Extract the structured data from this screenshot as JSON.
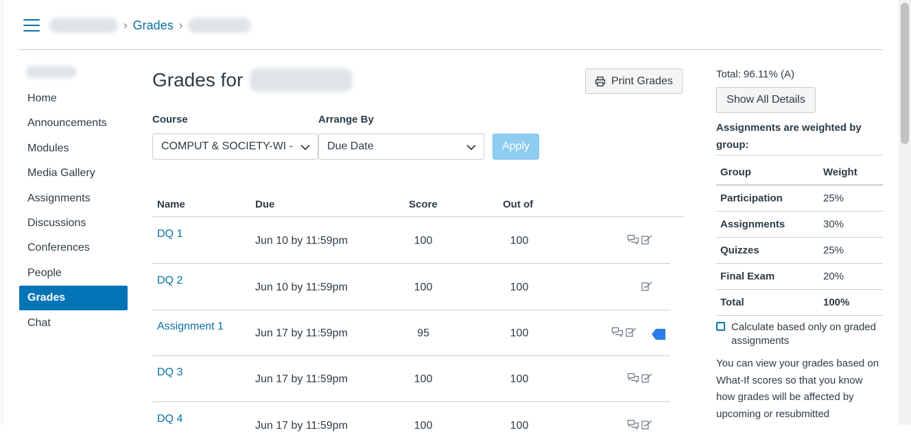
{
  "breadcrumb": {
    "current": "Grades"
  },
  "sidebar": {
    "items": [
      {
        "label": "Home"
      },
      {
        "label": "Announcements"
      },
      {
        "label": "Modules"
      },
      {
        "label": "Media Gallery"
      },
      {
        "label": "Assignments"
      },
      {
        "label": "Discussions"
      },
      {
        "label": "Conferences"
      },
      {
        "label": "People"
      },
      {
        "label": "Grades",
        "active": true
      },
      {
        "label": "Chat"
      }
    ]
  },
  "main": {
    "title": "Grades for",
    "print_label": "Print Grades",
    "course_label": "Course",
    "course_value": "COMPUT & SOCIETY-WI -",
    "arrange_label": "Arrange By",
    "arrange_value": "Due Date",
    "apply_label": "Apply",
    "columns": {
      "name": "Name",
      "due": "Due",
      "score": "Score",
      "out_of": "Out of"
    },
    "rows": [
      {
        "name": "DQ 1",
        "due": "Jun 10 by 11:59pm",
        "score": "100",
        "out_of": "100",
        "icons": [
          "comments-icon",
          "rubric-icon"
        ]
      },
      {
        "name": "DQ 2",
        "due": "Jun 10 by 11:59pm",
        "score": "100",
        "out_of": "100",
        "icons": [
          "rubric-icon"
        ]
      },
      {
        "name": "Assignment 1",
        "due": "Jun 17 by 11:59pm",
        "score": "95",
        "out_of": "100",
        "icons": [
          "comments-icon",
          "rubric-icon"
        ],
        "flag": true
      },
      {
        "name": "DQ 3",
        "due": "Jun 17 by 11:59pm",
        "score": "100",
        "out_of": "100",
        "icons": [
          "comments-icon",
          "rubric-icon"
        ]
      },
      {
        "name": "DQ 4",
        "due": "Jun 17 by 11:59pm",
        "score": "100",
        "out_of": "100",
        "icons": [
          "comments-icon",
          "rubric-icon"
        ]
      }
    ]
  },
  "sidebar_right": {
    "total": "Total: 96.11% (A)",
    "show_details_label": "Show All Details",
    "weighted_text": "Assignments are weighted by group:",
    "weights_header": {
      "group": "Group",
      "weight": "Weight"
    },
    "weights": [
      {
        "group": "Participation",
        "weight": "25%"
      },
      {
        "group": "Assignments",
        "weight": "30%"
      },
      {
        "group": "Quizzes",
        "weight": "25%"
      },
      {
        "group": "Final Exam",
        "weight": "20%"
      },
      {
        "group": "Total",
        "weight": "100%"
      }
    ],
    "calc_label": "Calculate based only on graded assignments",
    "whatif_text": "You can view your grades based on What-If scores so that you know how grades will be affected by upcoming or resubmitted"
  },
  "colors": {
    "link": "#0770a3",
    "active_nav": "#0374b5",
    "apply_disabled": "#8ecdf0",
    "flag": "#2b7de9"
  }
}
